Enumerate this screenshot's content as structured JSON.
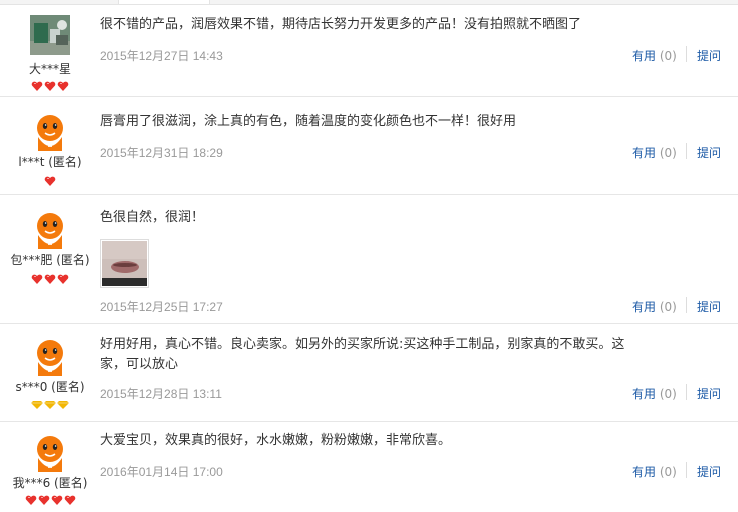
{
  "reviews": [
    {
      "username": "大***星",
      "content": "很不错的产品，润唇效果不错，期待店长努力开发更多的产品！没有拍照就不晒图了",
      "date": "2015年12月27日 14:43",
      "useful_label": "有用",
      "useful_count": "(0)",
      "ask_label": "提问",
      "avatar": "photo-avatar",
      "badge_type": "red-heart",
      "badge_count": 3
    },
    {
      "username": "l***t (匿名)",
      "content": "唇膏用了很滋润，涂上真的有色，随着温度的变化颜色也不一样！很好用",
      "date": "2015年12月31日 18:29",
      "useful_label": "有用",
      "useful_count": "(0)",
      "ask_label": "提问",
      "avatar": "taobao-mascot-icon",
      "badge_type": "red-heart",
      "badge_count": 1
    },
    {
      "username": "包***肥 (匿名)",
      "content": "色很自然，很润！",
      "date": "2015年12月25日 17:27",
      "useful_label": "有用",
      "useful_count": "(0)",
      "ask_label": "提问",
      "avatar": "taobao-mascot-icon",
      "badge_type": "red-heart",
      "badge_count": 3,
      "has_photo": true
    },
    {
      "username": "s***0 (匿名)",
      "content": "好用好用，真心不错。良心卖家。如另外的买家所说:买这种手工制品，别家真的不敢买。这家，可以放心",
      "date": "2015年12月28日 13:11",
      "useful_label": "有用",
      "useful_count": "(0)",
      "ask_label": "提问",
      "avatar": "taobao-mascot-icon",
      "badge_type": "gold-diamond",
      "badge_count": 3
    },
    {
      "username": "我***6 (匿名)",
      "content": "大爱宝贝，效果真的很好，水水嫩嫩，粉粉嫩嫩，非常欣喜。",
      "date": "2016年01月14日 17:00",
      "useful_label": "有用",
      "useful_count": "(0)",
      "ask_label": "提问",
      "avatar": "taobao-mascot-icon",
      "badge_type": "red-heart",
      "badge_count": 4
    }
  ],
  "colors": {
    "link": "#1c5aa6",
    "muted": "#999999",
    "heart": "#e8322d",
    "diamond": "#f2b705",
    "mascot": "#f47a0c"
  }
}
